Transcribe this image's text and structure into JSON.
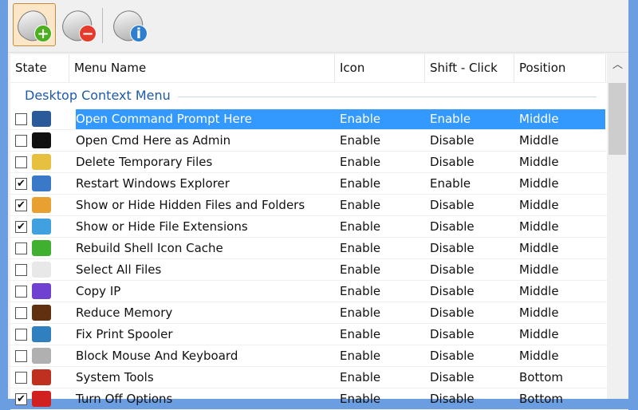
{
  "toolbar": {
    "buttons": [
      {
        "name": "add-menu",
        "badge": "+",
        "color": "#4caf20"
      },
      {
        "name": "remove-menu",
        "badge": "−",
        "color": "#e53b2c"
      },
      {
        "name": "info",
        "badge": "i",
        "color": "#2f7fd0"
      }
    ]
  },
  "columns": [
    "State",
    "Menu Name",
    "Icon",
    "Shift - Click",
    "Position"
  ],
  "group": "Desktop Context Menu",
  "rows": [
    {
      "checked": false,
      "name": "Open Command Prompt Here",
      "icon": "enable",
      "shift": "Enable",
      "pos": "Middle",
      "icon_color": "#2a5a9a",
      "selected": true,
      "iconval": "Enable"
    },
    {
      "checked": false,
      "name": "Open Cmd Here as Admin",
      "iconval": "Enable",
      "shift": "Disable",
      "pos": "Middle",
      "icon_color": "#111"
    },
    {
      "checked": false,
      "name": "Delete Temporary Files",
      "iconval": "Enable",
      "shift": "Disable",
      "pos": "Middle",
      "icon_color": "#e8c040"
    },
    {
      "checked": true,
      "name": "Restart Windows Explorer",
      "iconval": "Enable",
      "shift": "Enable",
      "pos": "Middle",
      "icon_color": "#3a78c8"
    },
    {
      "checked": true,
      "name": "Show or Hide Hidden Files and Folders",
      "iconval": "Enable",
      "shift": "Disable",
      "pos": "Middle",
      "icon_color": "#e8a030"
    },
    {
      "checked": true,
      "name": "Show or Hide File Extensions",
      "iconval": "Enable",
      "shift": "Disable",
      "pos": "Middle",
      "icon_color": "#40a0e0"
    },
    {
      "checked": false,
      "name": "Rebuild Shell Icon Cache",
      "iconval": "Enable",
      "shift": "Disable",
      "pos": "Middle",
      "icon_color": "#40b030"
    },
    {
      "checked": false,
      "name": "Select All Files",
      "iconval": "Enable",
      "shift": "Disable",
      "pos": "Middle",
      "icon_color": "#e8e8e8"
    },
    {
      "checked": false,
      "name": "Copy IP",
      "iconval": "Enable",
      "shift": "Disable",
      "pos": "Middle",
      "icon_color": "#7040d0"
    },
    {
      "checked": false,
      "name": "Reduce Memory",
      "iconval": "Enable",
      "shift": "Disable",
      "pos": "Middle",
      "icon_color": "#603010"
    },
    {
      "checked": false,
      "name": "Fix Print Spooler",
      "iconval": "Enable",
      "shift": "Disable",
      "pos": "Middle",
      "icon_color": "#3080c0"
    },
    {
      "checked": false,
      "name": "Block Mouse And Keyboard",
      "iconval": "Enable",
      "shift": "Disable",
      "pos": "Middle",
      "icon_color": "#b0b0b0"
    },
    {
      "checked": false,
      "name": "System Tools",
      "iconval": "Enable",
      "shift": "Disable",
      "pos": "Bottom",
      "icon_color": "#c03020"
    },
    {
      "checked": true,
      "name": "Turn Off Options",
      "iconval": "Enable",
      "shift": "Disable",
      "pos": "Bottom",
      "icon_color": "#d02020"
    }
  ]
}
